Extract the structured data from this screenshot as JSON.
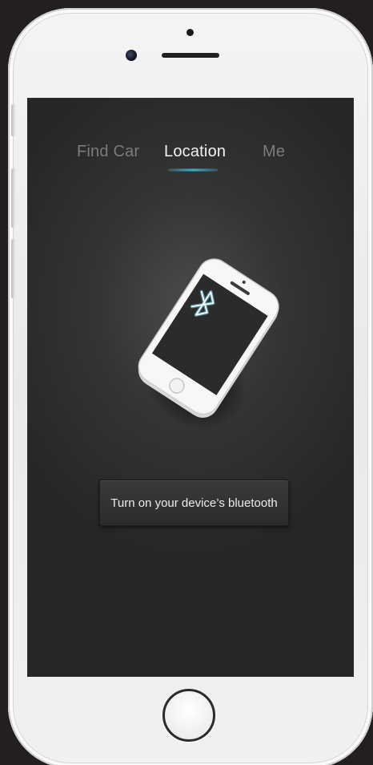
{
  "tabs": [
    {
      "label": "Find Car",
      "active": false
    },
    {
      "label": "Location",
      "active": true
    },
    {
      "label": "Me",
      "active": false
    }
  ],
  "illustration": {
    "icon": "bluetooth-icon",
    "accent_color": "#3ec7e8"
  },
  "action": {
    "label": "Turn on your device’s bluetooth"
  }
}
